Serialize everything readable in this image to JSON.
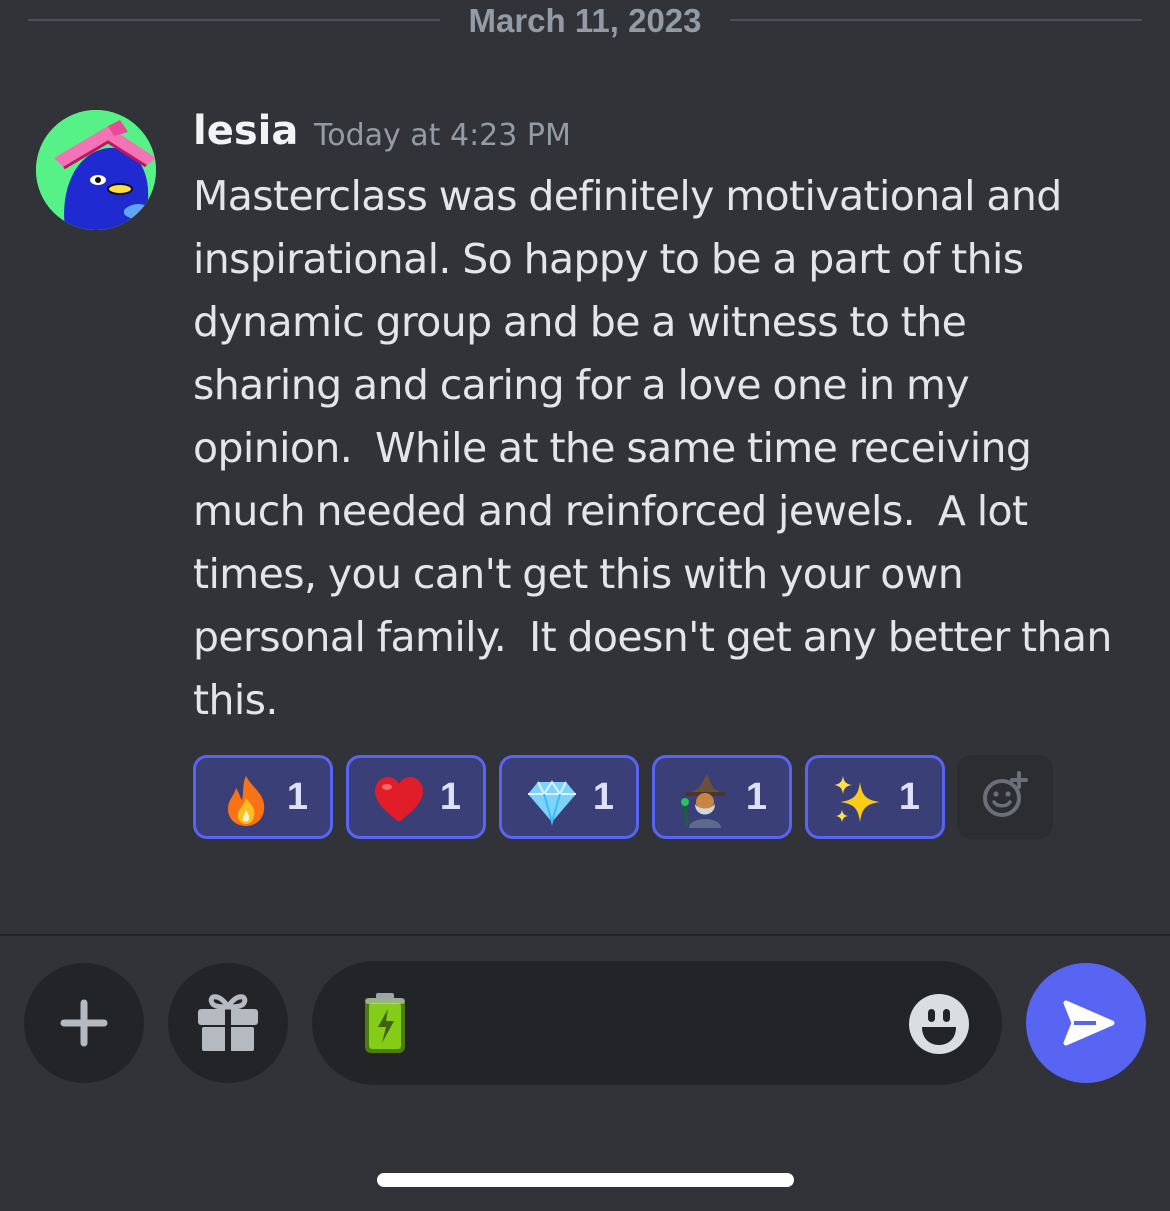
{
  "date_divider": {
    "label": "March 11, 2023"
  },
  "message": {
    "author": "lesia",
    "timestamp": "Today at 4:23 PM",
    "lines": [
      "Masterclass was definitely motivational and",
      "inspirational. So happy to be a part of this",
      "dynamic group and be a witness to the",
      "sharing and caring for a love one in my",
      "opinion.  While at the same time receiving",
      "much needed and reinforced jewels.  A lot",
      "times, you can't get this with your own",
      "personal family.  It doesn't get any better than",
      "this."
    ]
  },
  "reactions": [
    {
      "icon": "fire-icon",
      "count": "1"
    },
    {
      "icon": "red-heart-icon",
      "count": "1"
    },
    {
      "icon": "gem-icon",
      "count": "1"
    },
    {
      "icon": "wizard-icon",
      "count": "1"
    },
    {
      "icon": "sparkles-icon",
      "count": "1"
    }
  ],
  "add_reaction": {
    "icon": "add-reaction-icon"
  },
  "composer": {
    "plus_icon": "plus-icon",
    "gift_icon": "gift-icon",
    "input_value_icon": "battery-icon",
    "emoji_picker_icon": "smiley-icon",
    "send_icon": "send-icon"
  },
  "colors": {
    "background": "#313338",
    "reaction_fill": "#3b3f78",
    "reaction_border": "#5865f2",
    "send_button": "#5865f2",
    "input_background": "#232428",
    "muted_text": "#949ba4"
  }
}
